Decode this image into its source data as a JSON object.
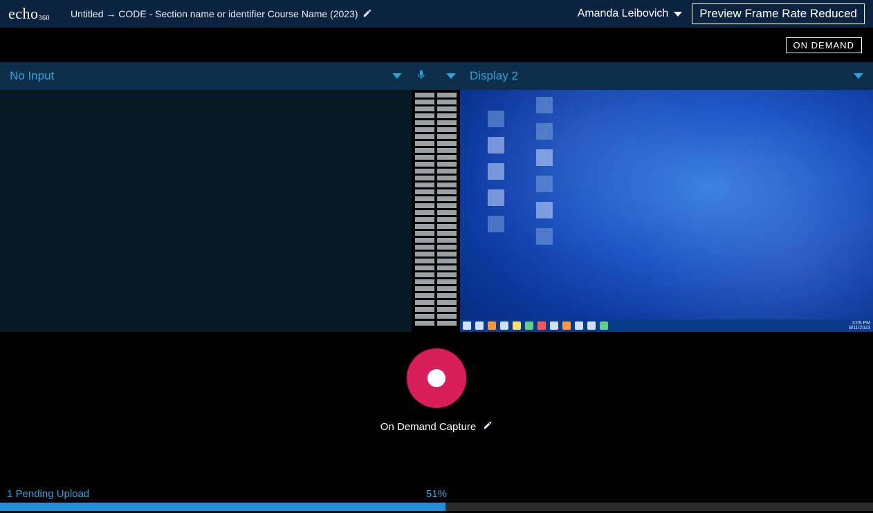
{
  "header": {
    "logo_text": "echo",
    "logo_sub": "360",
    "breadcrumb": "Untitled → CODE - Section name or identifier Course Name (2023)",
    "user_name": "Amanda Leibovich",
    "framerate_notice": "Preview Frame Rate Reduced"
  },
  "subbar": {
    "badge": "ON DEMAND"
  },
  "panels": {
    "left_label": "No Input",
    "right_label": "Display 2"
  },
  "desktop_preview": {
    "clock_time": "3:05 PM",
    "clock_date": "8/11/2023"
  },
  "controls": {
    "capture_label": "On Demand Capture"
  },
  "footer": {
    "pending_text": "1 Pending Upload",
    "percent_text": "51%",
    "percent_value": 51
  }
}
